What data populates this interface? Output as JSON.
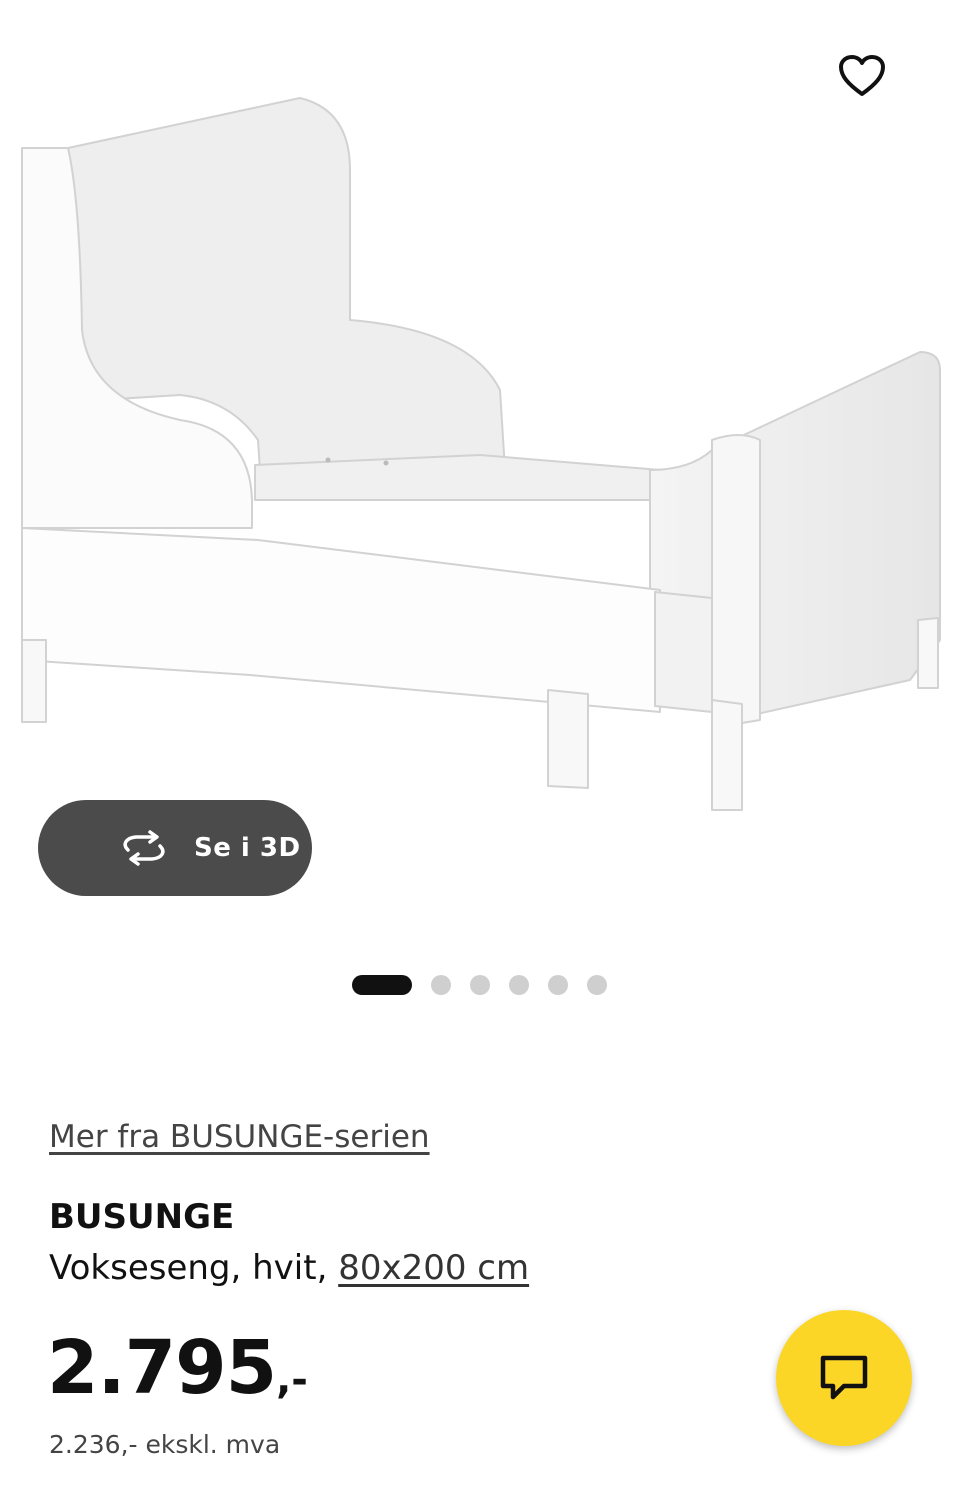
{
  "gallery": {
    "image_alt": "BUSUNGE vokseseng, hvit",
    "view_3d_label": "Se i 3D",
    "favorite_icon": "heart-outline-icon",
    "rotate_icon": "rotate-3d-icon",
    "dots": {
      "count": 6,
      "active_index": 0
    }
  },
  "product": {
    "series_link": "Mer fra BUSUNGE-serien",
    "name": "BUSUNGE",
    "description": "Vokseseng, hvit, ",
    "size_link": "80x200 cm",
    "price_main": "2.795",
    "price_suffix": ",-",
    "price_excl_vat": "2.236,- ekskl. mva"
  },
  "chat": {
    "icon": "chat-bubble-icon",
    "color": "#fcd627"
  },
  "colors": {
    "accent": "#fcd627",
    "dark_button": "#4b4b4b",
    "text": "#111111"
  }
}
